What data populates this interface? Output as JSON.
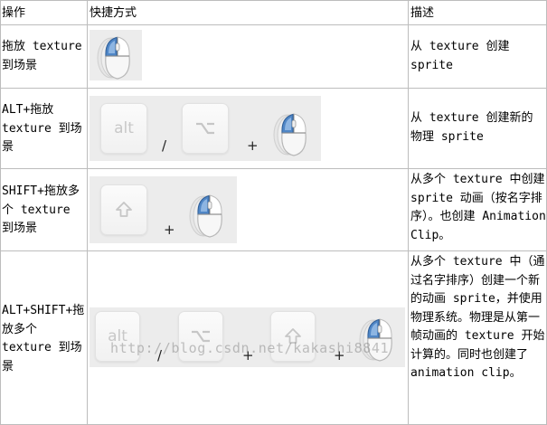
{
  "header": {
    "col1": "操作",
    "col2": "快捷方式",
    "col3": "描述"
  },
  "rows": [
    {
      "action": "拖放 texture 到场景",
      "description": "从 texture 创建 sprite"
    },
    {
      "action": "ALT+拖放 texture 到场景",
      "description": "从 texture 创建新的物理 sprite",
      "shortcut": {
        "key1": "alt",
        "sep1": "/",
        "sep2": "+"
      }
    },
    {
      "action": "SHIFT+拖放多个 texture 到场景",
      "description": "从多个 texture 中创建 sprite 动画（按名字排序）。也创建 Animation Clip。",
      "shortcut": {
        "sep1": "+"
      }
    },
    {
      "action": "ALT+SHIFT+拖放多个 texture 到场景",
      "description": "从多个 texture 中（通过名字排序）创建一个新的动画 sprite，并使用物理系统。物理是从第一帧动画的 texture 开始计算的。同时也创建了 animation clip。",
      "shortcut": {
        "key1": "alt",
        "sep1": "/",
        "sep2": "+",
        "sep3": "+"
      }
    }
  ],
  "watermark": "http://blog.csdn.net/kakashi8841",
  "icons": {
    "mouse": "mouse-left-click-icon",
    "option_key": "option-key-icon",
    "shift_key": "shift-key-icon"
  },
  "colors": {
    "grid": "#bdbdbd",
    "mouse_highlight": "#4f86c6",
    "key_bg": "#f4f4f4"
  }
}
